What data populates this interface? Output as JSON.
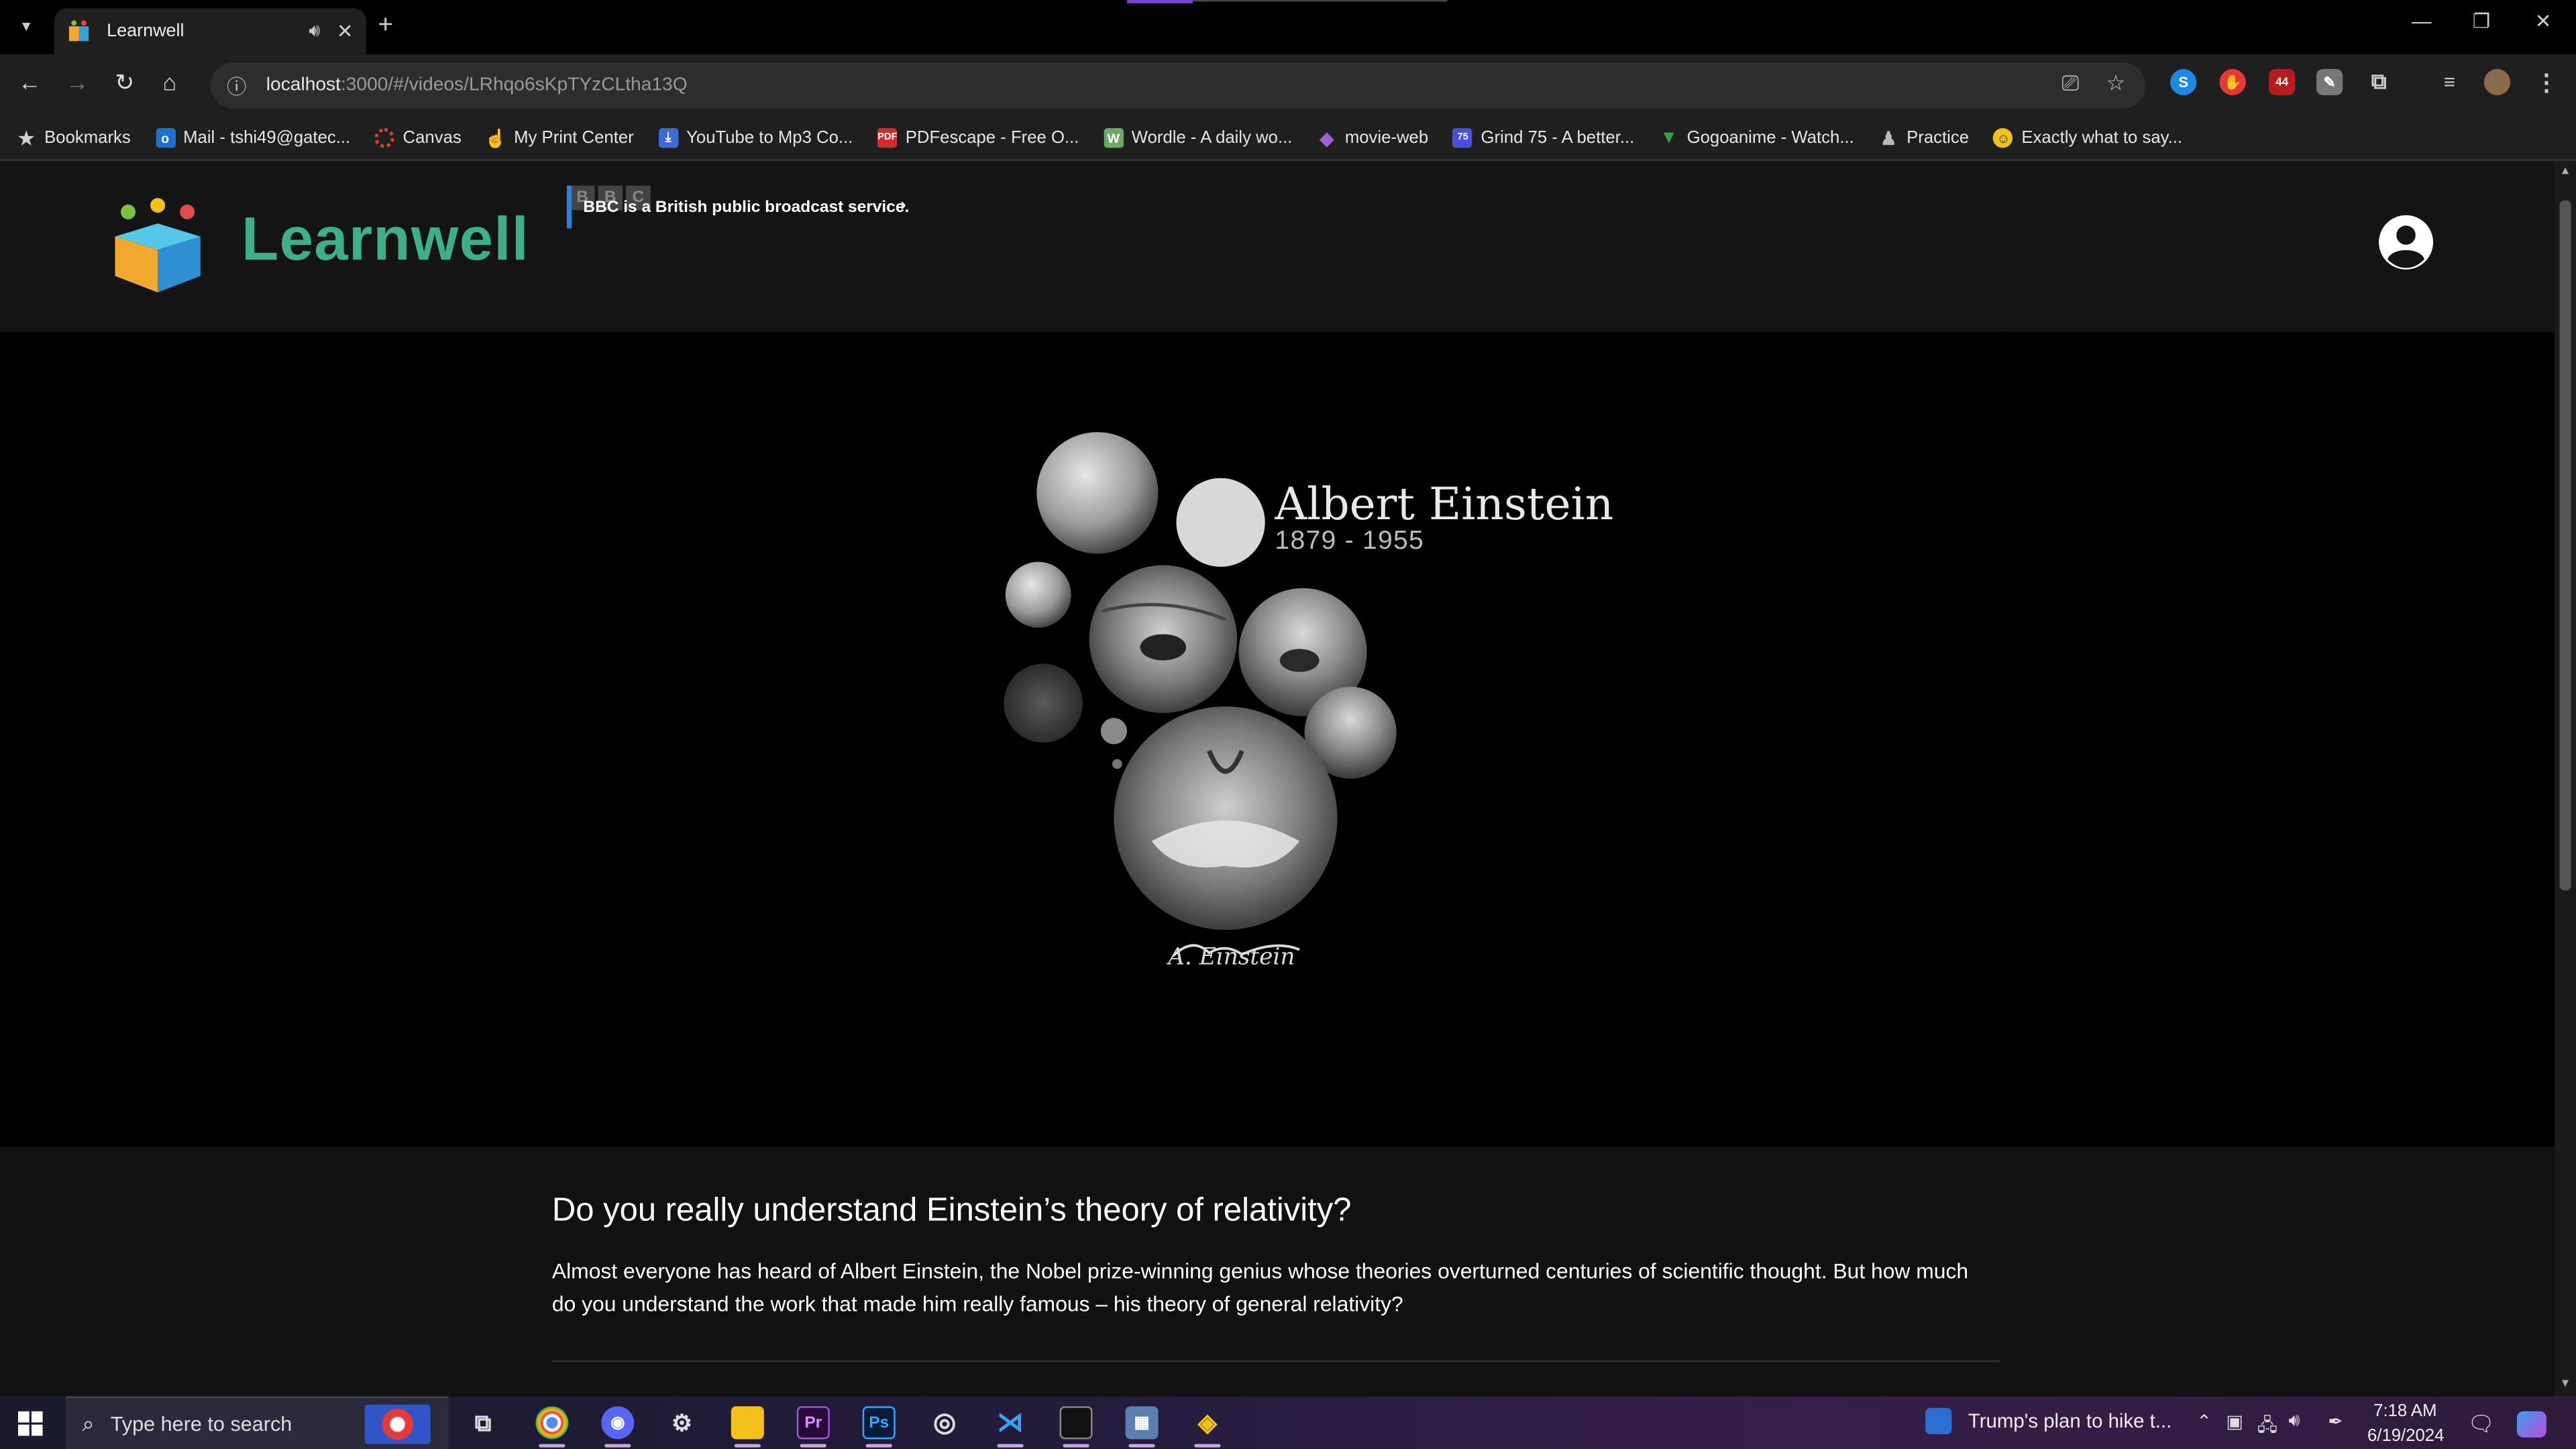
{
  "browser": {
    "tab_title": "Learnwell",
    "url_host": "localhost",
    "url_path": ":3000/#/videos/LRhqo6sKpTYzCLtha13Q",
    "bookmarks": [
      {
        "label": "Bookmarks",
        "icon": "star-icon",
        "color": "#cfcfcf"
      },
      {
        "label": "Mail - tshi49@gatec...",
        "icon": "outlook-icon",
        "color": "#1f6fd1"
      },
      {
        "label": "Canvas",
        "icon": "canvas-icon",
        "color": "#e23b2e"
      },
      {
        "label": "My Print Center",
        "icon": "print-hand-icon",
        "color": "#f0b52b"
      },
      {
        "label": "YouTube to Mp3 Co...",
        "icon": "download-icon",
        "color": "#3d6ad6"
      },
      {
        "label": "PDFescape - Free O...",
        "icon": "pdf-icon",
        "color": "#d12b2b"
      },
      {
        "label": "Wordle - A daily wo...",
        "icon": "wordle-icon",
        "color": "#6aaa64"
      },
      {
        "label": "movie-web",
        "icon": "movie-web-icon",
        "color": "#a45dd8"
      },
      {
        "label": "Grind 75 - A better...",
        "icon": "grind75-icon",
        "color": "#4b4fd8"
      },
      {
        "label": "Gogoanime - Watch...",
        "icon": "gogoanime-icon",
        "color": "#2fa34a"
      },
      {
        "label": "Practice",
        "icon": "practice-icon",
        "color": "#bbbbbb"
      },
      {
        "label": "Exactly what to say...",
        "icon": "smiley-icon",
        "color": "#f2c21b"
      }
    ]
  },
  "app": {
    "brand": "Learnwell",
    "video": {
      "badge_text": "BBC is a British public broadcast service.",
      "bbc_letters": [
        "B",
        "B",
        "C"
      ],
      "overlay_name": "Albert Einstein",
      "overlay_years": "1879 - 1955",
      "title": "Do you really understand Einstein’s theory of relativity?",
      "description": "Almost everyone has heard of Albert Einstein, the Nobel prize-winning genius whose theories overturned centuries of scientific thought. But how much do you understand the work that made him really famous – his theory of general relativity?"
    }
  },
  "taskbar": {
    "search_placeholder": "Type here to search",
    "news": "Trump's plan to hike t...",
    "time": "7:18 AM",
    "date": "6/19/2024"
  }
}
